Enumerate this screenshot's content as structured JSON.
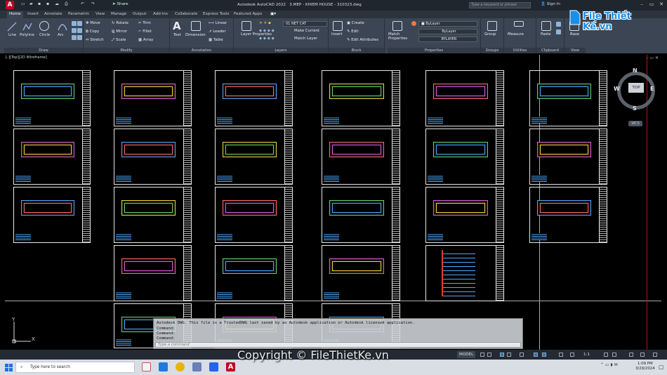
{
  "titlebar": {
    "app_title": "Autodesk AutoCAD 2022",
    "file_title": "3.MEP - KHIEM HOUSE - 310323.dwg",
    "share_label": "Share",
    "search_placeholder": "Type a keyword or phrase",
    "signin_label": "Sign In"
  },
  "tabs": [
    "Home",
    "Insert",
    "Annotate",
    "Parametric",
    "View",
    "Manage",
    "Output",
    "Add-ins",
    "Collaborate",
    "Express Tools",
    "Featured Apps"
  ],
  "ribbon": {
    "draw": {
      "title": "Draw",
      "line": "Line",
      "polyline": "Polyline",
      "circle": "Circle",
      "arc": "Arc"
    },
    "modify": {
      "title": "Modify",
      "move": "Move",
      "rotate": "Rotate",
      "trim": "Trim",
      "copy": "Copy",
      "mirror": "Mirror",
      "fillet": "Fillet",
      "stretch": "Stretch",
      "scale": "Scale",
      "array": "Array"
    },
    "annotation": {
      "title": "Annotation",
      "text": "Text",
      "dimension": "Dimension",
      "linear": "Linear",
      "leader": "Leader",
      "table": "Table"
    },
    "layers": {
      "title": "Layers",
      "layer_properties": "Layer Properties",
      "current_layer": "01 NET CAT",
      "make_current": "Make Current",
      "match_layer": "Match Layer"
    },
    "block": {
      "title": "Block",
      "insert": "Insert",
      "create": "Create",
      "edit": "Edit",
      "edit_attributes": "Edit Attributes"
    },
    "properties": {
      "title": "Properties",
      "match_properties": "Match Properties",
      "color": "ByLayer",
      "lineweight": "ByLayer",
      "linetype": "BYLAYER"
    },
    "groups": {
      "title": "Groups",
      "group": "Group"
    },
    "utilities": {
      "title": "Utilities",
      "measure": "Measure"
    },
    "clipboard": {
      "title": "Clipboard",
      "paste": "Paste"
    },
    "view": {
      "title": "View",
      "base": "Base"
    }
  },
  "viewport": {
    "label": "[-][Top][2D Wireframe]",
    "viewcube": {
      "face": "TOP",
      "north": "N",
      "south": "S",
      "east": "E",
      "west": "W",
      "wcs": "WCS"
    },
    "ucs": {
      "x": "X",
      "y": "Y"
    }
  },
  "command": {
    "lines": [
      "Autodesk DWG.  This file is a TrustedDWG last saved by an Autodesk application or Autodesk licensed application.",
      "Command:",
      "Command:",
      "Command:"
    ],
    "input_placeholder": "Type a command"
  },
  "statusbar": {
    "model": "MODEL",
    "scale": "1:1"
  },
  "taskbar": {
    "search_placeholder": "Type here to search",
    "time": "1:09 PM",
    "date": "3/29/2024"
  },
  "watermark": {
    "logo_text": "File Thiết Kế.vn",
    "copyright": "Copyright © FileThietKe.vn"
  },
  "colors": {
    "accent": "#c3001f",
    "ribbon": "#3b4553",
    "titlebar": "#20262e",
    "watermark": "#1b8fe8"
  }
}
